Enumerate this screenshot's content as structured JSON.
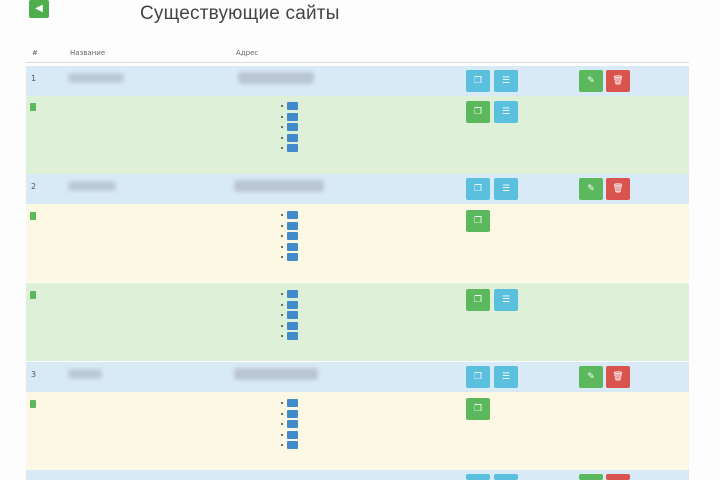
{
  "back_button_icon": "arrow-left-icon",
  "title": "Существующие сайты",
  "columns": [
    "#",
    "Название",
    "Адрес"
  ],
  "sites": [
    {
      "num": "1",
      "details": [
        {
          "status": "",
          "items": [
            {
              "tag": "",
              "label": ""
            },
            {
              "tag": "",
              "label": ""
            },
            {
              "tag": "",
              "label": ""
            },
            {
              "tag": "",
              "label": ""
            },
            {
              "tag": "",
              "label": ""
            }
          ]
        }
      ]
    },
    {
      "num": "2",
      "details": [
        {
          "status": "",
          "items": [
            {
              "tag": "",
              "label": ""
            },
            {
              "tag": "",
              "label": ""
            },
            {
              "tag": "",
              "label": ""
            },
            {
              "tag": "",
              "label": ""
            },
            {
              "tag": "",
              "label": ""
            }
          ]
        },
        {
          "status": "",
          "items": [
            {
              "tag": "",
              "label": ""
            },
            {
              "tag": "",
              "label": ""
            },
            {
              "tag": "",
              "label": ""
            },
            {
              "tag": "",
              "label": ""
            },
            {
              "tag": "",
              "label": ""
            }
          ]
        }
      ]
    },
    {
      "num": "3",
      "details": [
        {
          "status": "",
          "items": [
            {
              "tag": "",
              "label": ""
            },
            {
              "tag": "",
              "label": ""
            },
            {
              "tag": "",
              "label": ""
            },
            {
              "tag": "",
              "label": ""
            },
            {
              "tag": "",
              "label": ""
            }
          ]
        }
      ]
    }
  ],
  "icons": {
    "info_a": "copy-icon",
    "info_b": "list-icon",
    "success_a": "edit-icon",
    "danger_a": "trash-icon",
    "detail_success": "copy-icon",
    "detail_info": "list-icon"
  }
}
